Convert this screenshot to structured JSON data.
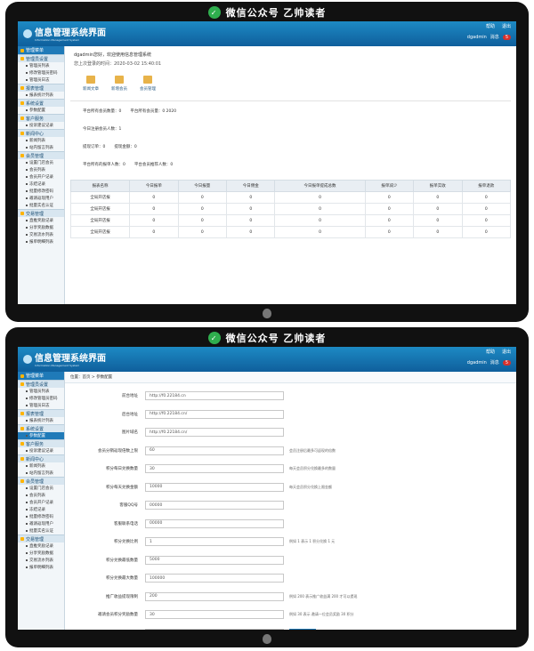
{
  "watermark": "微信公众号  乙帅读者",
  "header": {
    "title": "信息管理系统界面",
    "subtitle": "Information Management System",
    "links": [
      "帮助",
      "退出"
    ],
    "user": "dgadmin",
    "user_suffix": "消息",
    "badge": "5"
  },
  "sidebar": {
    "head": "管理菜单",
    "groups": [
      {
        "label": "管理员设置",
        "items": [
          "管理员列表",
          "修改管理员密码",
          "管理员日志"
        ]
      },
      {
        "label": "报表管理",
        "items": [
          "报表统计列表"
        ]
      },
      {
        "label": "系统设置",
        "items": [
          "参数配置"
        ]
      },
      {
        "label": "客户服务",
        "items": [
          "投诉建议记录"
        ]
      },
      {
        "label": "新闻中心",
        "items": [
          "新闻列表",
          "站内留言列表"
        ]
      },
      {
        "label": "会员管理",
        "items": [
          "设置门店会员",
          "会员列表",
          "会员开户记录",
          "冻结记录",
          "批量修改密码",
          "邀请返现用户",
          "批量实名认证"
        ]
      },
      {
        "label": "交易管理",
        "items": [
          "直推奖励记录",
          "分享奖励数据",
          "交易流水列表",
          "报单明细列表"
        ]
      }
    ]
  },
  "dashboard": {
    "welcome": "dgadmin您好，欢迎使用信息管理系统",
    "last_login": "您上次登录的时间：2020-03-02 15:40:01",
    "quick": [
      "新闻文章",
      "新增会员",
      "会员管理"
    ],
    "stats_rows": [
      [
        "平台所有会员数量：0",
        "平台所有会员量：0 2020"
      ],
      [
        "今日注册会员人数：1"
      ],
      [
        "提现订单：0",
        "提现金额：0"
      ],
      [
        "平台所有的报单人数：0",
        "平台会员推荐人数：0"
      ]
    ],
    "table": {
      "headers": [
        "报表名称",
        "今日报单",
        "今日报量",
        "今日佣金",
        "今日报单提成总数",
        "报单减少",
        "报单实收",
        "报单退款"
      ],
      "rows": [
        [
          "全局开店报",
          "0",
          "0",
          "0",
          "0",
          "0",
          "0",
          "0"
        ],
        [
          "全局开店报",
          "0",
          "0",
          "0",
          "0",
          "0",
          "0",
          "0"
        ],
        [
          "全局开店报",
          "0",
          "0",
          "0",
          "0",
          "0",
          "0",
          "0"
        ],
        [
          "全局开店报",
          "0",
          "0",
          "0",
          "0",
          "0",
          "0",
          "0"
        ]
      ]
    }
  },
  "settings": {
    "breadcrumb": "位置：首页 > 参数配置",
    "rows": [
      {
        "label": "前台地址",
        "value": "http://f0.22184.cn",
        "note": ""
      },
      {
        "label": "后台地址",
        "value": "http://f0.22184.cn/",
        "note": ""
      },
      {
        "label": "图片域名",
        "value": "http://f0.22184.cn/",
        "note": ""
      },
      {
        "label": "会员分销返现倍数上限",
        "value": "60",
        "note": "会员注册后最多可返现的倍数"
      },
      {
        "label": "积分每日兑换数量",
        "value": "30",
        "note": "每天会员积分兑换最多的数量"
      },
      {
        "label": "积分每天兑换金额",
        "value": "10000",
        "note": "每天会员积分兑换上限金额"
      },
      {
        "label": "客服QQ号",
        "value": "00000",
        "note": ""
      },
      {
        "label": "客服联系电话",
        "value": "00000",
        "note": ""
      },
      {
        "label": "积分兑换比例",
        "value": "1",
        "note": "例如 1 表示 1 积分兑换 1 元"
      },
      {
        "label": "积分兑换最低数量",
        "value": "5000",
        "note": ""
      },
      {
        "label": "积分兑换最大数量",
        "value": "100000",
        "note": ""
      },
      {
        "label": "推广收益提现限制",
        "value": "200",
        "note": "例如 200 表示推广收益满 200 才可以提现"
      },
      {
        "label": "邀请会员积分奖励数量",
        "value": "30",
        "note": "例如 30 表示 邀请一位会员奖励 30 积分"
      },
      {
        "label": "",
        "value": "",
        "note": ""
      }
    ]
  },
  "colors": {
    "accent": "#1f7ab8",
    "header": "#0f5f9c"
  }
}
